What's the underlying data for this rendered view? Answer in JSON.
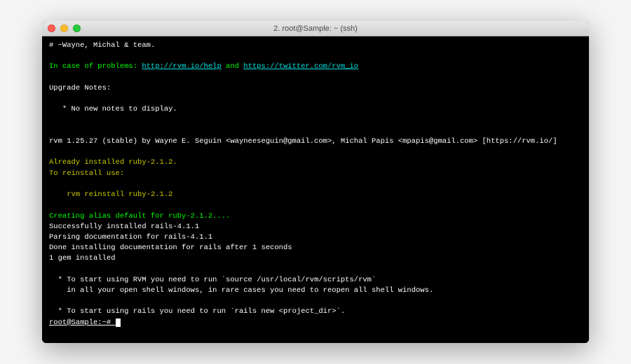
{
  "title": "2. root@Sample: ~ (ssh)",
  "lines": {
    "comment": "# ~Wayne, Michal & team.",
    "problems_prefix": "In case of problems: ",
    "help_url": "http://rvm.io/help",
    "and": " and ",
    "twitter_url": "https://twitter.com/rvm_io",
    "upgrade_notes": "Upgrade Notes:",
    "no_notes": "   * No new notes to display.",
    "rvm_version": "rvm 1.25.27 (stable) by Wayne E. Seguin <wayneeseguin@gmail.com>, Michal Papis <mpapis@gmail.com> [https://rvm.io/]",
    "already_installed": "Already installed ruby-2.1.2.",
    "to_reinstall": "To reinstall use:",
    "reinstall_cmd": "    rvm reinstall ruby-2.1.2",
    "creating_alias": "Creating alias default for ruby-2.1.2....",
    "rails_installed": "Successfully installed rails-4.1.1",
    "parsing_doc": "Parsing documentation for rails-4.1.1",
    "done_doc": "Done installing documentation for rails after 1 seconds",
    "gem_installed": "1 gem installed",
    "start_rvm": "  * To start using RVM you need to run `source /usr/local/rvm/scripts/rvm`",
    "start_rvm2": "    in all your open shell windows, in rare cases you need to reopen all shell windows.",
    "start_rails": "  * To start using rails you need to run `rails new <project_dir>`.",
    "prompt": "root@Sample:~# "
  }
}
